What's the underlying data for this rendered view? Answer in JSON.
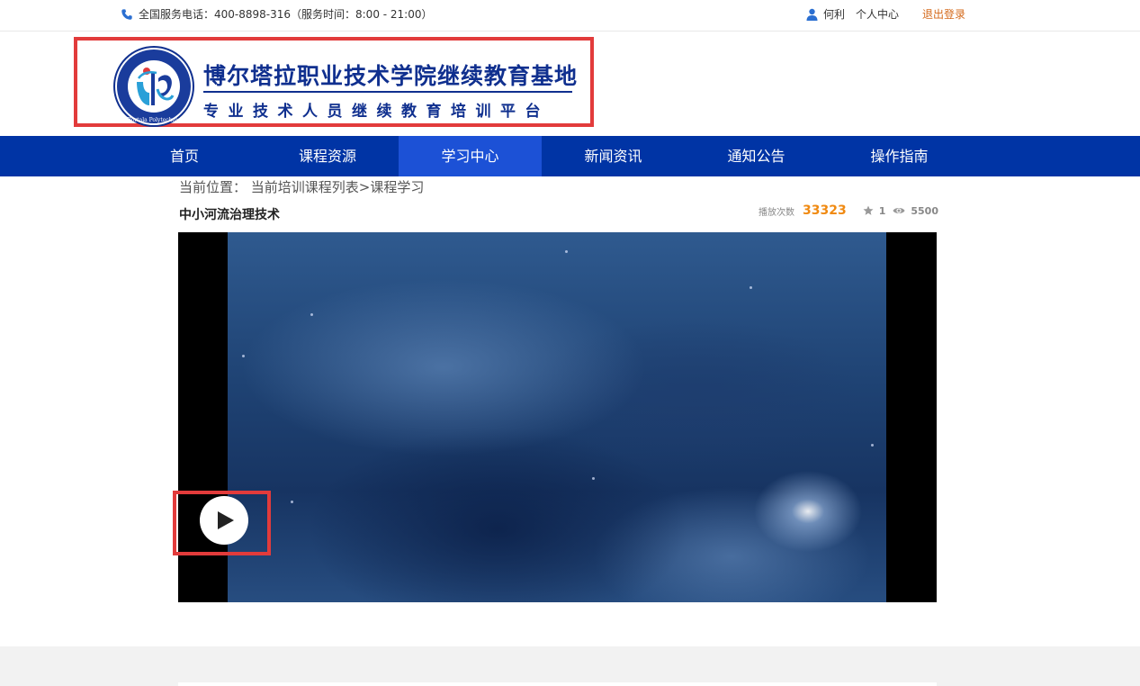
{
  "topbar": {
    "phone_text": "全国服务电话：400-8898-316（服务时间：8:00 - 21:00）",
    "user_name": "何利",
    "personal_center": "个人中心",
    "logout": "退出登录"
  },
  "header": {
    "title": "博尔塔拉职业技术学院继续教育基地",
    "subtitle": "专业技术人员继续教育培训平台",
    "emblem_text": "Bortala Polytechnic"
  },
  "nav": {
    "items": [
      {
        "label": "首页",
        "active": false
      },
      {
        "label": "课程资源",
        "active": false
      },
      {
        "label": "学习中心",
        "active": true
      },
      {
        "label": "新闻资讯",
        "active": false
      },
      {
        "label": "通知公告",
        "active": false
      },
      {
        "label": "操作指南",
        "active": false
      }
    ]
  },
  "breadcrumb": {
    "text": "当前位置： 当前培训课程列表>课程学习"
  },
  "course": {
    "title": "中小河流治理技术",
    "play_label": "播放次数",
    "play_count": "33323",
    "likes": "1",
    "views": "5500"
  },
  "video": {
    "play_icon": "play-icon"
  },
  "colors": {
    "nav_bg": "#0034a5",
    "nav_active": "#1c51d6",
    "brand": "#10308f",
    "accent_orange": "#f08a12",
    "highlight_red": "#e23b3b"
  }
}
